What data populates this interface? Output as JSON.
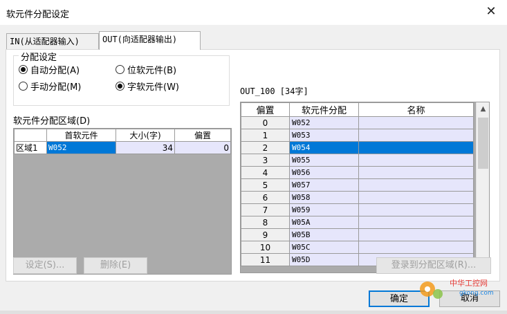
{
  "window": {
    "title": "软元件分配设定",
    "close_glyph": "✕"
  },
  "tabs": [
    {
      "label": "IN(从适配器输入)",
      "active": false
    },
    {
      "label": "OUT(向适配器输出)",
      "active": true
    }
  ],
  "allocation": {
    "legend": "分配设定",
    "auto_label": "自动分配(A)",
    "manual_label": "手动分配(M)",
    "bit_label": "位软元件(B)",
    "word_label": "字软元件(W)",
    "selected_mode": "auto",
    "selected_type": "word"
  },
  "area": {
    "label": "软元件分配区域(D)",
    "headers": [
      "首软元件",
      "大小(字)",
      "偏置"
    ],
    "rows": [
      {
        "name": "区域1",
        "first": "W052",
        "size": "34",
        "offset": "0"
      }
    ]
  },
  "out_table": {
    "title": "OUT_100 [34字]",
    "headers": [
      "偏置",
      "软元件分配",
      "名称"
    ],
    "selected_index": 2,
    "rows": [
      {
        "offset": "0",
        "device": "W052",
        "name": ""
      },
      {
        "offset": "1",
        "device": "W053",
        "name": ""
      },
      {
        "offset": "2",
        "device": "W054",
        "name": ""
      },
      {
        "offset": "3",
        "device": "W055",
        "name": ""
      },
      {
        "offset": "4",
        "device": "W056",
        "name": ""
      },
      {
        "offset": "5",
        "device": "W057",
        "name": ""
      },
      {
        "offset": "6",
        "device": "W058",
        "name": ""
      },
      {
        "offset": "7",
        "device": "W059",
        "name": ""
      },
      {
        "offset": "8",
        "device": "W05A",
        "name": ""
      },
      {
        "offset": "9",
        "device": "W05B",
        "name": ""
      },
      {
        "offset": "10",
        "device": "W05C",
        "name": ""
      },
      {
        "offset": "11",
        "device": "W05D",
        "name": ""
      }
    ]
  },
  "buttons": {
    "settings": "设定(S)...",
    "delete": "删除(E)",
    "register": "登录到分配区域(R)...",
    "ok": "确定",
    "cancel": "取消"
  },
  "watermark": {
    "cn": "中华工控网",
    "url": "gkong.com"
  },
  "colors": {
    "selection": "#0078d7",
    "cell_bg": "#e6e6fb",
    "empty_area": "#ababab"
  }
}
